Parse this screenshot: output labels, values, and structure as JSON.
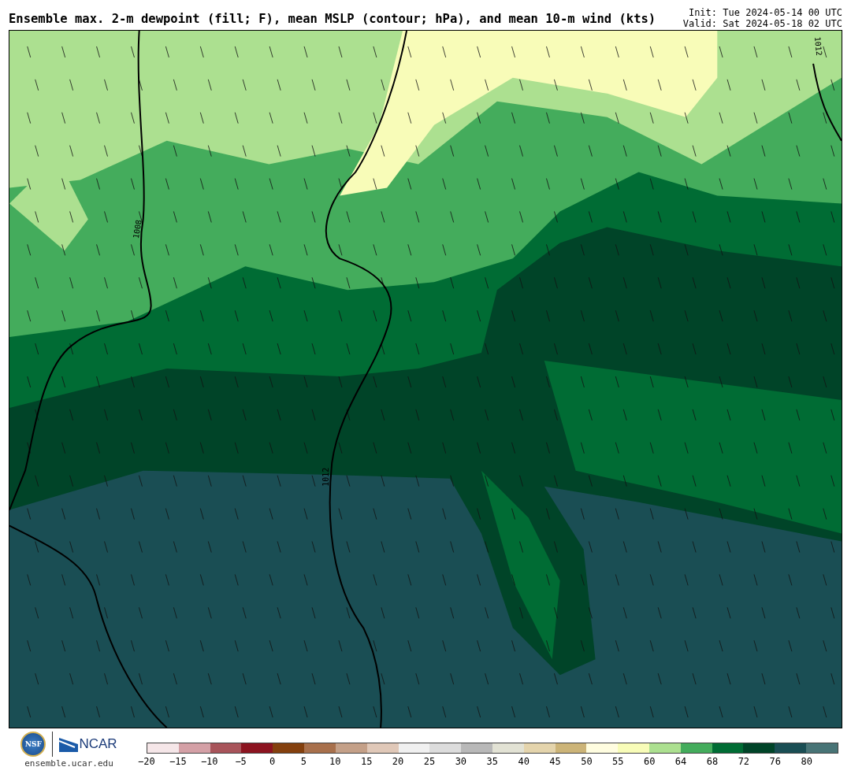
{
  "header": {
    "title": "Ensemble max. 2-m dewpoint (fill; F), mean MSLP (contour; hPa), and mean 10-m wind (kts)",
    "init": "Init: Tue 2024-05-14 00 UTC",
    "valid": "Valid: Sat 2024-05-18 02 UTC"
  },
  "map": {
    "contour_labels": [
      "1008",
      "1012",
      "1012"
    ]
  },
  "footer": {
    "nsf_logo": "NSF",
    "ncar_logo": "NCAR",
    "site": "ensemble.ucar.edu"
  },
  "colorbar": {
    "swatches": [
      {
        "color": "#f5e6e8"
      },
      {
        "color": "#d4a0a6"
      },
      {
        "color": "#a8545a"
      },
      {
        "color": "#8c1420"
      },
      {
        "color": "#84400e"
      },
      {
        "color": "#a8704c"
      },
      {
        "color": "#c4a088"
      },
      {
        "color": "#e0c8b8"
      },
      {
        "color": "#f0f0f0"
      },
      {
        "color": "#dcdcdc"
      },
      {
        "color": "#b8b8b8"
      },
      {
        "color": "#e2e2d4"
      },
      {
        "color": "#e4d4ac"
      },
      {
        "color": "#ccb478"
      },
      {
        "color": "#fffde0"
      },
      {
        "color": "#f8fcb8"
      },
      {
        "color": "#ace090"
      },
      {
        "color": "#44ac5c"
      },
      {
        "color": "#006c34"
      },
      {
        "color": "#004428"
      },
      {
        "color": "#1a4e54"
      },
      {
        "color": "#487476"
      }
    ],
    "labels": [
      "−20",
      "−15",
      "−10",
      "−5",
      "0",
      "5",
      "10",
      "15",
      "20",
      "25",
      "30",
      "35",
      "40",
      "45",
      "50",
      "55",
      "60",
      "64",
      "68",
      "72",
      "76",
      "80"
    ]
  }
}
